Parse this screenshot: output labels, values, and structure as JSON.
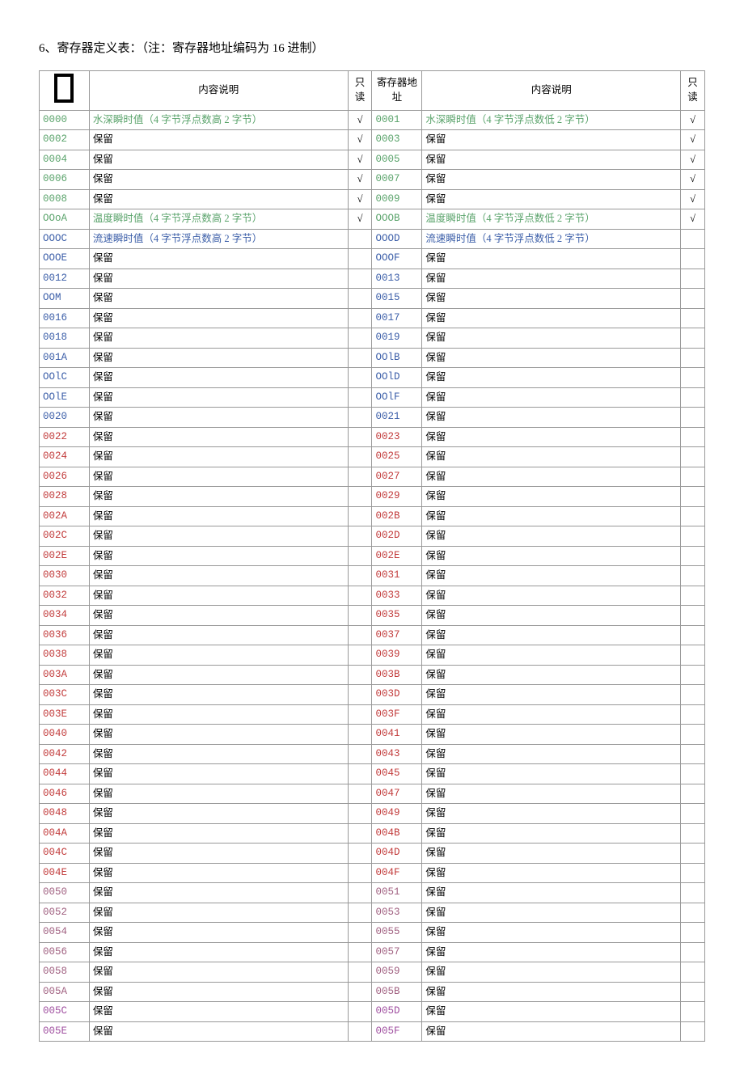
{
  "title": "6、寄存器定义表：（注：寄存器地址编码为 16 进制）",
  "headers": {
    "desc": "内容说明",
    "ro": "只读",
    "addr": "寄存器地址"
  },
  "rows": [
    {
      "a1": "0000",
      "c1": "green",
      "d1": "水深瞬时值（4 字节浮点数高 2 字节）",
      "dc1": "green",
      "r1": "√",
      "a2": "0001",
      "c2": "green",
      "d2": "水深瞬时值（4 字节浮点数低 2 字节）",
      "dc2": "green",
      "r2": "√"
    },
    {
      "a1": "0002",
      "c1": "green",
      "d1": "保留",
      "r1": "√",
      "a2": "0003",
      "c2": "green",
      "d2": "保留",
      "r2": "√"
    },
    {
      "a1": "0004",
      "c1": "green",
      "d1": "保留",
      "r1": "√",
      "a2": "0005",
      "c2": "green",
      "d2": "保留",
      "r2": "√"
    },
    {
      "a1": "0006",
      "c1": "green",
      "d1": "保留",
      "r1": "√",
      "a2": "0007",
      "c2": "green",
      "d2": "保留",
      "r2": "√"
    },
    {
      "a1": "0008",
      "c1": "green",
      "d1": "保留",
      "r1": "√",
      "a2": "0009",
      "c2": "green",
      "d2": "保留",
      "r2": "√"
    },
    {
      "a1": "OOoA",
      "c1": "green",
      "d1": "温度瞬时值（4 字节浮点数高 2 字节）",
      "dc1": "green",
      "r1": "√",
      "a2": "OOOB",
      "c2": "green",
      "d2": "温度瞬时值（4 字节浮点数低 2 字节）",
      "dc2": "green",
      "r2": "√"
    },
    {
      "a1": "OOOC",
      "c1": "blue",
      "d1": "流速瞬时值（4 字节浮点数高 2 字节）",
      "dc1": "blue",
      "r1": "",
      "a2": "OOOD",
      "c2": "blue",
      "d2": "流速瞬时值（4 字节浮点数低 2 字节）",
      "dc2": "blue",
      "r2": ""
    },
    {
      "a1": "OOOE",
      "c1": "blue",
      "d1": "保留",
      "r1": "",
      "a2": "OOOF",
      "c2": "blue",
      "d2": "保留",
      "r2": ""
    },
    {
      "a1": "0012",
      "c1": "blue",
      "d1": "保留",
      "r1": "",
      "a2": "0013",
      "c2": "blue",
      "d2": "保留",
      "r2": ""
    },
    {
      "a1": "OOM",
      "c1": "blue",
      "d1": "保留",
      "r1": "",
      "a2": "0015",
      "c2": "blue",
      "d2": "保留",
      "r2": ""
    },
    {
      "a1": "0016",
      "c1": "blue",
      "d1": "保留",
      "r1": "",
      "a2": "0017",
      "c2": "blue",
      "d2": "保留",
      "r2": ""
    },
    {
      "a1": "0018",
      "c1": "blue",
      "d1": "保留",
      "r1": "",
      "a2": "0019",
      "c2": "blue",
      "d2": "保留",
      "r2": ""
    },
    {
      "a1": "001A",
      "c1": "blue",
      "d1": "保留",
      "r1": "",
      "a2": "OOlB",
      "c2": "blue",
      "d2": "保留",
      "r2": ""
    },
    {
      "a1": "OOlC",
      "c1": "blue",
      "d1": "保留",
      "r1": "",
      "a2": "OOlD",
      "c2": "blue",
      "d2": "保留",
      "r2": ""
    },
    {
      "a1": "OOlE",
      "c1": "blue",
      "d1": "保留",
      "r1": "",
      "a2": "OOlF",
      "c2": "blue",
      "d2": "保留",
      "r2": ""
    },
    {
      "a1": "0020",
      "c1": "blue",
      "d1": "保留",
      "r1": "",
      "a2": "0021",
      "c2": "blue",
      "d2": "保留",
      "r2": ""
    },
    {
      "a1": "0022",
      "c1": "red",
      "d1": "保留",
      "r1": "",
      "a2": "0023",
      "c2": "red",
      "d2": "保留",
      "r2": ""
    },
    {
      "a1": "0024",
      "c1": "red",
      "d1": "保留",
      "r1": "",
      "a2": "0025",
      "c2": "red",
      "d2": "保留",
      "r2": ""
    },
    {
      "a1": "0026",
      "c1": "red",
      "d1": "保留",
      "r1": "",
      "a2": "0027",
      "c2": "red",
      "d2": "保留",
      "r2": ""
    },
    {
      "a1": "0028",
      "c1": "red",
      "d1": "保留",
      "r1": "",
      "a2": "0029",
      "c2": "red",
      "d2": "保留",
      "r2": ""
    },
    {
      "a1": "002A",
      "c1": "red",
      "d1": "保留",
      "r1": "",
      "a2": "002B",
      "c2": "red",
      "d2": "保留",
      "r2": ""
    },
    {
      "a1": "002C",
      "c1": "red",
      "d1": "保留",
      "r1": "",
      "a2": "002D",
      "c2": "red",
      "d2": "保留",
      "r2": ""
    },
    {
      "a1": "002E",
      "c1": "red",
      "d1": "保留",
      "r1": "",
      "a2": "002E",
      "c2": "red",
      "d2": "保留",
      "r2": ""
    },
    {
      "a1": "0030",
      "c1": "red",
      "d1": "保留",
      "r1": "",
      "a2": "0031",
      "c2": "red",
      "d2": "保留",
      "r2": ""
    },
    {
      "a1": "0032",
      "c1": "red",
      "d1": "保留",
      "r1": "",
      "a2": "0033",
      "c2": "red",
      "d2": "保留",
      "r2": ""
    },
    {
      "a1": "0034",
      "c1": "red",
      "d1": "保留",
      "r1": "",
      "a2": "0035",
      "c2": "red",
      "d2": "保留",
      "r2": ""
    },
    {
      "a1": "0036",
      "c1": "red",
      "d1": "保留",
      "r1": "",
      "a2": "0037",
      "c2": "red",
      "d2": "保留",
      "r2": ""
    },
    {
      "a1": "0038",
      "c1": "red",
      "d1": "保留",
      "r1": "",
      "a2": "0039",
      "c2": "red",
      "d2": "保留",
      "r2": ""
    },
    {
      "a1": "003A",
      "c1": "red",
      "d1": "保留",
      "r1": "",
      "a2": "003B",
      "c2": "red",
      "d2": "保留",
      "r2": ""
    },
    {
      "a1": "003C",
      "c1": "red",
      "d1": "保留",
      "r1": "",
      "a2": "003D",
      "c2": "red",
      "d2": "保留",
      "r2": ""
    },
    {
      "a1": "003E",
      "c1": "red",
      "d1": "保留",
      "r1": "",
      "a2": "003F",
      "c2": "red",
      "d2": "保留",
      "r2": ""
    },
    {
      "a1": "0040",
      "c1": "red",
      "d1": "保留",
      "r1": "",
      "a2": "0041",
      "c2": "red",
      "d2": "保留",
      "r2": ""
    },
    {
      "a1": "0042",
      "c1": "red",
      "d1": "保留",
      "r1": "",
      "a2": "0043",
      "c2": "red",
      "d2": "保留",
      "r2": ""
    },
    {
      "a1": "0044",
      "c1": "red",
      "d1": "保留",
      "r1": "",
      "a2": "0045",
      "c2": "red",
      "d2": "保留",
      "r2": ""
    },
    {
      "a1": "0046",
      "c1": "red",
      "d1": "保留",
      "r1": "",
      "a2": "0047",
      "c2": "red",
      "d2": "保留",
      "r2": ""
    },
    {
      "a1": "0048",
      "c1": "red",
      "d1": "保留",
      "r1": "",
      "a2": "0049",
      "c2": "red",
      "d2": "保留",
      "r2": ""
    },
    {
      "a1": "004A",
      "c1": "red",
      "d1": "保留",
      "r1": "",
      "a2": "004B",
      "c2": "red",
      "d2": "保留",
      "r2": ""
    },
    {
      "a1": "004C",
      "c1": "red",
      "d1": "保留",
      "r1": "",
      "a2": "004D",
      "c2": "red",
      "d2": "保留",
      "r2": ""
    },
    {
      "a1": "004E",
      "c1": "red",
      "d1": "保留",
      "r1": "",
      "a2": "004F",
      "c2": "red",
      "d2": "保留",
      "r2": ""
    },
    {
      "a1": "0050",
      "c1": "",
      "d1": "保留",
      "r1": "",
      "a2": "0051",
      "c2": "",
      "d2": "保留",
      "r2": ""
    },
    {
      "a1": "0052",
      "c1": "",
      "d1": "保留",
      "r1": "",
      "a2": "0053",
      "c2": "",
      "d2": "保留",
      "r2": ""
    },
    {
      "a1": "0054",
      "c1": "",
      "d1": "保留",
      "r1": "",
      "a2": "0055",
      "c2": "",
      "d2": "保留",
      "r2": ""
    },
    {
      "a1": "0056",
      "c1": "",
      "d1": "保留",
      "r1": "",
      "a2": "0057",
      "c2": "",
      "d2": "保留",
      "r2": ""
    },
    {
      "a1": "0058",
      "c1": "",
      "d1": "保留",
      "r1": "",
      "a2": "0059",
      "c2": "",
      "d2": "保留",
      "r2": ""
    },
    {
      "a1": "005A",
      "c1": "",
      "d1": "保留",
      "r1": "",
      "a2": "005B",
      "c2": "",
      "d2": "保留",
      "r2": ""
    },
    {
      "a1": "005C",
      "c1": "purple",
      "d1": "保留",
      "r1": "",
      "a2": "005D",
      "c2": "purple",
      "d2": "保留",
      "r2": ""
    },
    {
      "a1": "005E",
      "c1": "purple",
      "d1": "保留",
      "r1": "",
      "a2": "005F",
      "c2": "purple",
      "d2": "保留",
      "r2": ""
    }
  ]
}
